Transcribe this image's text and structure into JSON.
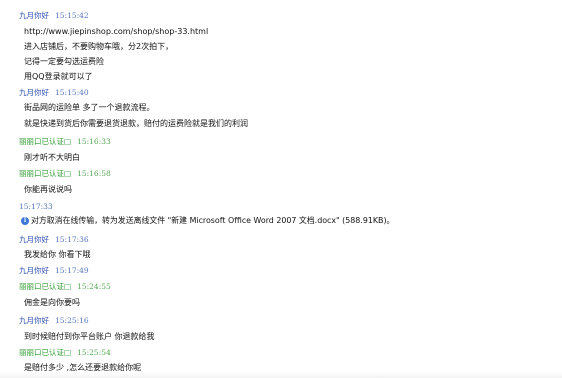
{
  "colors": {
    "self_sender": "#2a4fb0",
    "other_sender": "#2f9a2f",
    "message_text": "#111111",
    "info_icon": "#3c78d8"
  },
  "messages": [
    {
      "sender": "九月你好",
      "role": "self",
      "time": "15:15:42",
      "lines": [
        "http://www.jiepinshop.com/shop/shop-33.html",
        "进入店铺后，不要购物车哦，分2次拍下，",
        "记得一定要勾选运费险",
        "用QQ登录就可以了"
      ]
    },
    {
      "sender": "九月你好",
      "role": "self",
      "time": "15:15:40",
      "lines": [
        "街品网的运险单 多了一个退款流程。",
        "就是快递到货后你需要退货退款，赔付的运费险就是我们的利润"
      ]
    },
    {
      "sender": "丽丽口已认证□",
      "role": "other",
      "time": "15:16:33",
      "lines": [
        "刚才听不大明白"
      ]
    },
    {
      "sender": "丽丽口已认证□",
      "role": "other",
      "time": "15:16:58",
      "lines": [
        "你能再说说吗"
      ]
    },
    {
      "sender": "",
      "role": "system",
      "time": "15:17:33",
      "icon": "info-icon",
      "lines": [
        "对方取消在线传输，转为发送离线文件 \"新建 Microsoft Office Word 2007 文档.docx\" (588.91KB)。"
      ]
    },
    {
      "sender": "九月你好",
      "role": "self",
      "time": "15:17:36",
      "lines": [
        "我发给你 你看下哦"
      ]
    },
    {
      "sender": "九月你好",
      "role": "self",
      "time": "15:17:49",
      "lines": [
        ""
      ]
    },
    {
      "sender": "丽丽口已认证□",
      "role": "other",
      "time": "15:24:55",
      "lines": [
        "佣金是向你要吗"
      ]
    },
    {
      "sender": "九月你好",
      "role": "self",
      "time": "15:25:16",
      "lines": [
        "到时候赔付到你平台账户 你退款给我"
      ]
    },
    {
      "sender": "丽丽口已认证□",
      "role": "other",
      "time": "15:25:54",
      "lines": [
        "是赔付多少 ,怎么还要退款给你呢"
      ]
    }
  ]
}
